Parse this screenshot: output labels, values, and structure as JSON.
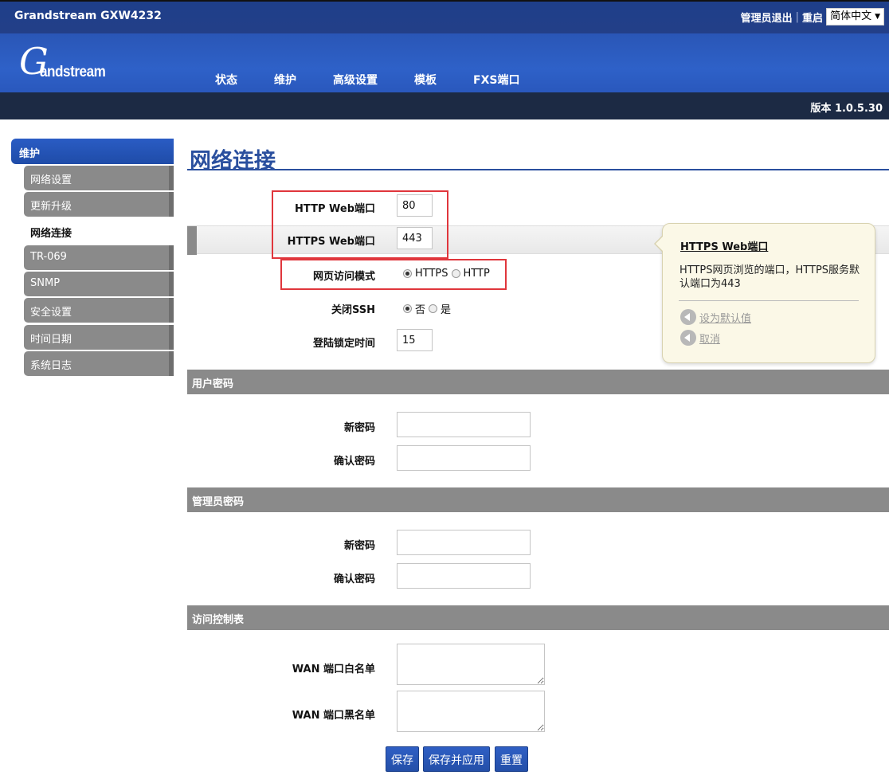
{
  "header": {
    "model": "Grandstream GXW4232",
    "logout": "管理员退出",
    "reboot": "重启",
    "language": "简体中文",
    "logo_text": "andstream",
    "version": "版本 1.0.5.30"
  },
  "nav": [
    "状态",
    "维护",
    "高级设置",
    "模板",
    "FXS端口"
  ],
  "sidebar": {
    "section": "维护",
    "items": [
      "网络设置",
      "更新升级",
      "网络连接",
      "TR-069",
      "SNMP",
      "安全设置",
      "时间日期",
      "系统日志"
    ]
  },
  "page": {
    "title": "网络连接",
    "http_port_label": "HTTP Web端口",
    "http_port_value": "80",
    "https_port_label": "HTTPS Web端口",
    "https_port_value": "443",
    "access_mode_label": "网页访问模式",
    "access_mode_options": [
      "HTTPS",
      "HTTP"
    ],
    "access_mode_selected": "HTTPS",
    "ssh_label": "关闭SSH",
    "ssh_options": [
      "否",
      "是"
    ],
    "ssh_selected": "否",
    "lock_label": "登陆锁定时间",
    "lock_value": "15"
  },
  "user_password": {
    "section": "用户密码",
    "new_label": "新密码",
    "confirm_label": "确认密码"
  },
  "admin_password": {
    "section": "管理员密码",
    "new_label": "新密码",
    "confirm_label": "确认密码"
  },
  "acl": {
    "section": "访问控制表",
    "whitelist_label": "WAN 端口白名单",
    "blacklist_label": "WAN 端口黑名单"
  },
  "buttons": {
    "save": "保存",
    "save_apply": "保存并应用",
    "reset": "重置"
  },
  "help": {
    "title": "HTTPS Web端口",
    "body": "HTTPS网页浏览的端口，HTTPS服务默认端口为443",
    "set_default": "设为默认值",
    "cancel": "取消"
  },
  "colors": {
    "brand_blue": "#2a56b6",
    "dark_bar": "#1c2a44",
    "highlight_red": "#e0363c",
    "section_gray": "#8a8a8a"
  }
}
